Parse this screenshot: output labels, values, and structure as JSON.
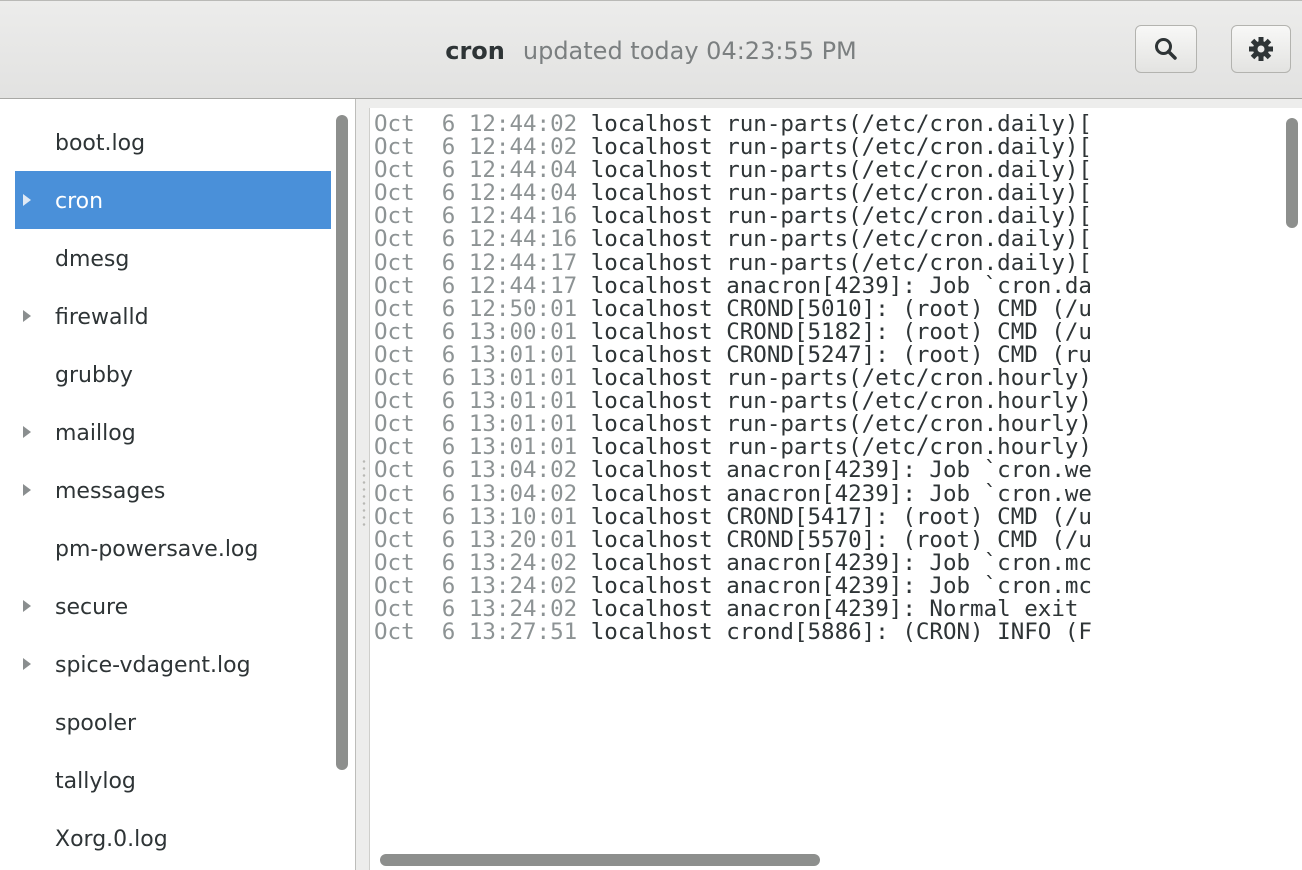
{
  "header": {
    "title": "cron",
    "subtitle": "updated today 04:23:55 PM",
    "search_icon": "search-icon",
    "settings_icon": "gear-icon"
  },
  "sidebar": {
    "items": [
      {
        "label": "boot.log",
        "expandable": false,
        "selected": false
      },
      {
        "label": "cron",
        "expandable": true,
        "selected": true
      },
      {
        "label": "dmesg",
        "expandable": false,
        "selected": false
      },
      {
        "label": "firewalld",
        "expandable": true,
        "selected": false
      },
      {
        "label": "grubby",
        "expandable": false,
        "selected": false
      },
      {
        "label": "maillog",
        "expandable": true,
        "selected": false
      },
      {
        "label": "messages",
        "expandable": true,
        "selected": false
      },
      {
        "label": "pm-powersave.log",
        "expandable": false,
        "selected": false
      },
      {
        "label": "secure",
        "expandable": true,
        "selected": false
      },
      {
        "label": "spice-vdagent.log",
        "expandable": true,
        "selected": false
      },
      {
        "label": "spooler",
        "expandable": false,
        "selected": false
      },
      {
        "label": "tallylog",
        "expandable": false,
        "selected": false
      },
      {
        "label": "Xorg.0.log",
        "expandable": false,
        "selected": false
      }
    ]
  },
  "log": {
    "lines": [
      {
        "ts": "Oct  6 12:44:02",
        "host": "localhost",
        "msg": "run-parts(/etc/cron.daily)["
      },
      {
        "ts": "Oct  6 12:44:02",
        "host": "localhost",
        "msg": "run-parts(/etc/cron.daily)["
      },
      {
        "ts": "Oct  6 12:44:04",
        "host": "localhost",
        "msg": "run-parts(/etc/cron.daily)["
      },
      {
        "ts": "Oct  6 12:44:04",
        "host": "localhost",
        "msg": "run-parts(/etc/cron.daily)["
      },
      {
        "ts": "Oct  6 12:44:16",
        "host": "localhost",
        "msg": "run-parts(/etc/cron.daily)["
      },
      {
        "ts": "Oct  6 12:44:16",
        "host": "localhost",
        "msg": "run-parts(/etc/cron.daily)["
      },
      {
        "ts": "Oct  6 12:44:17",
        "host": "localhost",
        "msg": "run-parts(/etc/cron.daily)["
      },
      {
        "ts": "Oct  6 12:44:17",
        "host": "localhost",
        "msg": "anacron[4239]: Job `cron.da"
      },
      {
        "ts": "Oct  6 12:50:01",
        "host": "localhost",
        "msg": "CROND[5010]: (root) CMD (/u"
      },
      {
        "ts": "Oct  6 13:00:01",
        "host": "localhost",
        "msg": "CROND[5182]: (root) CMD (/u"
      },
      {
        "ts": "Oct  6 13:01:01",
        "host": "localhost",
        "msg": "CROND[5247]: (root) CMD (ru"
      },
      {
        "ts": "Oct  6 13:01:01",
        "host": "localhost",
        "msg": "run-parts(/etc/cron.hourly)"
      },
      {
        "ts": "Oct  6 13:01:01",
        "host": "localhost",
        "msg": "run-parts(/etc/cron.hourly)"
      },
      {
        "ts": "Oct  6 13:01:01",
        "host": "localhost",
        "msg": "run-parts(/etc/cron.hourly)"
      },
      {
        "ts": "Oct  6 13:01:01",
        "host": "localhost",
        "msg": "run-parts(/etc/cron.hourly)"
      },
      {
        "ts": "Oct  6 13:04:02",
        "host": "localhost",
        "msg": "anacron[4239]: Job `cron.we"
      },
      {
        "ts": "Oct  6 13:04:02",
        "host": "localhost",
        "msg": "anacron[4239]: Job `cron.we"
      },
      {
        "ts": "Oct  6 13:10:01",
        "host": "localhost",
        "msg": "CROND[5417]: (root) CMD (/u"
      },
      {
        "ts": "Oct  6 13:20:01",
        "host": "localhost",
        "msg": "CROND[5570]: (root) CMD (/u"
      },
      {
        "ts": "Oct  6 13:24:02",
        "host": "localhost",
        "msg": "anacron[4239]: Job `cron.mc"
      },
      {
        "ts": "Oct  6 13:24:02",
        "host": "localhost",
        "msg": "anacron[4239]: Job `cron.mc"
      },
      {
        "ts": "Oct  6 13:24:02",
        "host": "localhost",
        "msg": "anacron[4239]: Normal exit"
      },
      {
        "ts": "Oct  6 13:27:51",
        "host": "localhost",
        "msg": "crond[5886]: (CRON) INFO (F"
      }
    ]
  },
  "colors": {
    "selection": "#4a90d9",
    "timestamp": "#8d9394",
    "text": "#2e3436"
  }
}
